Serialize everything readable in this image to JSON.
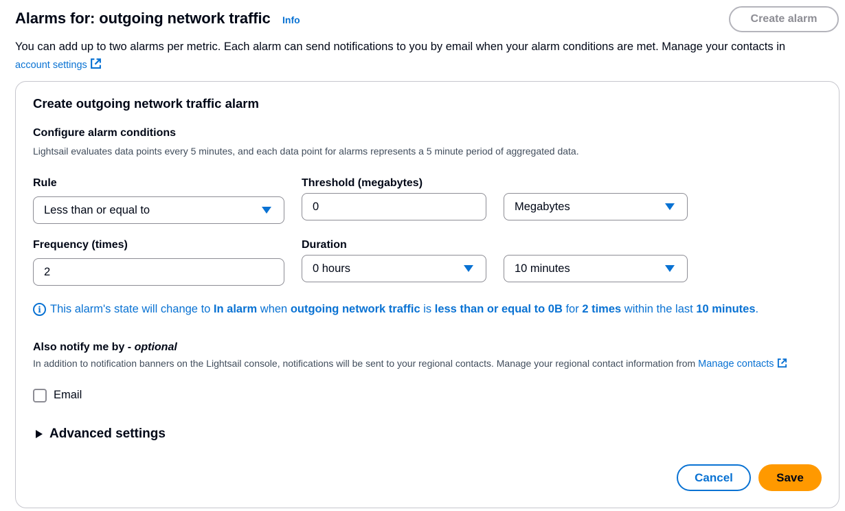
{
  "header": {
    "title": "Alarms for: outgoing network traffic",
    "info_label": "Info",
    "create_alarm_label": "Create alarm",
    "description": "You can add up to two alarms per metric. Each alarm can send notifications to you by email when your alarm conditions are met. Manage your contacts in",
    "account_settings_link": "account settings"
  },
  "panel": {
    "title": "Create outgoing network traffic alarm",
    "conditions_title": "Configure alarm conditions",
    "conditions_desc": "Lightsail evaluates data points every 5 minutes, and each data point for alarms represents a 5 minute period of aggregated data."
  },
  "rule": {
    "label": "Rule",
    "value": "Less than or equal to"
  },
  "threshold": {
    "label": "Threshold (megabytes)",
    "value": "0",
    "unit": "Megabytes"
  },
  "frequency": {
    "label": "Frequency (times)",
    "value": "2"
  },
  "duration": {
    "label": "Duration",
    "hours": "0 hours",
    "minutes": "10 minutes"
  },
  "alarm_message": {
    "p1": "This alarm's state will change to ",
    "state": "In alarm",
    "p2": " when ",
    "metric": "outgoing network traffic",
    "p3": " is ",
    "condition": "less than or equal to 0B",
    "p4": " for ",
    "times": "2 times",
    "p5": " within the last ",
    "period": "10 minutes",
    "p6": "."
  },
  "notify": {
    "title": "Also notify me by - ",
    "optional": "optional",
    "desc": "In addition to notification banners on the Lightsail console, notifications will be sent to your regional contacts. Manage your regional contact information from",
    "manage_contacts_link": "Manage contacts",
    "email_label": "Email",
    "email_checked": false
  },
  "advanced": {
    "label": "Advanced settings"
  },
  "footer": {
    "cancel_label": "Cancel",
    "save_label": "Save"
  },
  "colors": {
    "link": "#0972d3",
    "primary": "#ff9900",
    "text": "#000716",
    "border": "#8c8c94"
  }
}
